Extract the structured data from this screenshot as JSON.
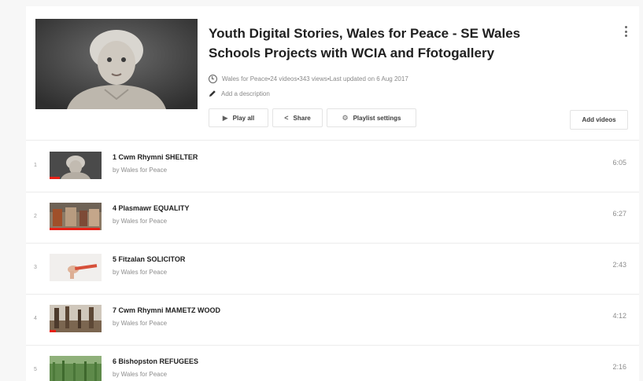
{
  "playlist": {
    "title": "Youth Digital Stories, Wales for Peace - SE Wales Schools Projects with WCIA and Ffotogallery",
    "meta": {
      "channel": "Wales for Peace",
      "video_count": "24 videos",
      "views": "343 views",
      "updated": "Last updated on 6 Aug 2017",
      "separator": " • "
    },
    "description_placeholder": "Add a description",
    "buttons": {
      "play_all": "Play all",
      "share": "Share",
      "settings": "Playlist settings",
      "add_videos": "Add videos"
    },
    "icons": {
      "privacy": "clock-icon",
      "edit": "pencil-icon",
      "play": "play-icon",
      "share": "share-icon",
      "settings": "gear-icon",
      "more": "more-vertical-icon"
    }
  },
  "videos": [
    {
      "index": "1",
      "title": "1 Cwm Rhymni SHELTER",
      "channel": "by Wales for Peace",
      "duration": "6:05",
      "watched_fraction": 0.2
    },
    {
      "index": "2",
      "title": "4 Plasmawr EQUALITY",
      "channel": "by Wales for Peace",
      "duration": "6:27",
      "watched_fraction": 0.97
    },
    {
      "index": "3",
      "title": "5 Fitzalan SOLICITOR",
      "channel": "by Wales for Peace",
      "duration": "2:43",
      "watched_fraction": 0
    },
    {
      "index": "4",
      "title": "7 Cwm Rhymni MAMETZ WOOD",
      "channel": "by Wales for Peace",
      "duration": "4:12",
      "watched_fraction": 0.12
    },
    {
      "index": "5",
      "title": "6 Bishopston REFUGEES",
      "channel": "by Wales for Peace",
      "duration": "2:16",
      "watched_fraction": 0
    }
  ],
  "colors": {
    "progress": "#e62117",
    "text": "#202020",
    "muted": "#8d8d8d"
  }
}
